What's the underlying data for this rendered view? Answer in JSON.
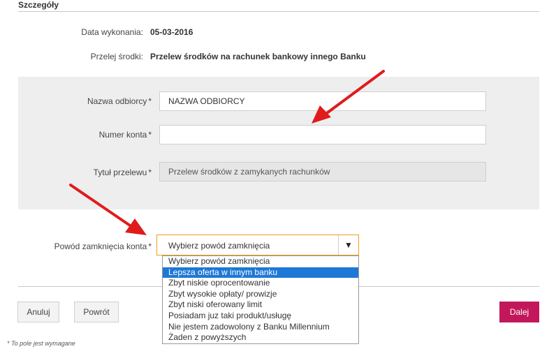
{
  "section": {
    "title": "Szczegóły"
  },
  "info": {
    "date_label": "Data wykonania:",
    "date_value": "05-03-2016",
    "transfer_label": "Przelej środki:",
    "transfer_value": "Przelew środków na rachunek bankowy innego Banku"
  },
  "form": {
    "recipient_label": "Nazwa odbiorcy",
    "recipient_value": "NAZWA ODBIORCY",
    "account_label": "Numer konta",
    "account_value": "",
    "title_label": "Tytuł przelewu",
    "title_value": "Przelew środków z zamykanych rachunków",
    "required_mark": "*"
  },
  "reason": {
    "label": "Powód zamknięcia konta",
    "selected": "Wybierz powód zamknięcia",
    "arrow_icon": "triangle-down",
    "options": [
      "Wybierz powód zamknięcia",
      "Lepsza oferta w innym banku",
      "Zbyt niskie oprocentowanie",
      "Zbyt wysokie opłaty/ prowizje",
      "Zbyt niski oferowany limit",
      "Posiadam juz taki produkt/usługę",
      "Nie jestem zadowolony z Banku Millennium",
      "Żaden z powyższych"
    ],
    "highlighted_index": 1
  },
  "buttons": {
    "cancel": "Anuluj",
    "back": "Powrót",
    "next": "Dalej"
  },
  "footnote": "* To pole jest wymagane",
  "colors": {
    "primary": "#c2185b",
    "highlight": "#1e78d6",
    "select_border": "#e8a020",
    "arrow": "#e01b1b"
  }
}
